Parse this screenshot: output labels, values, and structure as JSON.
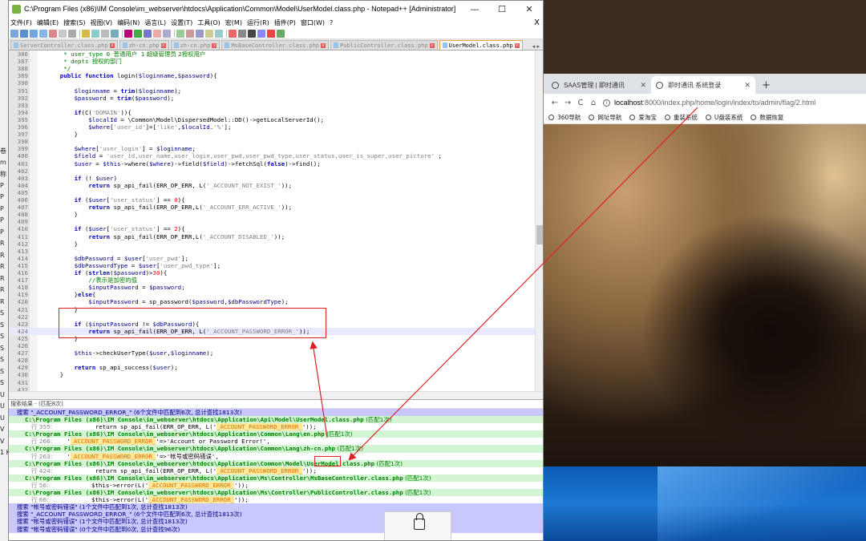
{
  "left_strip": {
    "labels": [
      "卷",
      "m",
      "称",
      "P",
      "P",
      "P",
      "P",
      "P",
      "R",
      "R",
      "R",
      "R",
      "R",
      "R",
      "S",
      "S",
      "S",
      "S",
      "S",
      "S",
      "S",
      "U",
      "U",
      "U",
      "V",
      "V",
      "1 K"
    ]
  },
  "npp": {
    "title": "C:\\Program Files (x86)\\IM Console\\im_webserver\\htdocs\\Application\\Common\\Model\\UserModel.class.php - Notepad++ [Administrator]",
    "window_buttons": {
      "minimize": "—",
      "maximize": "☐",
      "close": "✕"
    },
    "menu": [
      "文件(F)",
      "编辑(E)",
      "搜索(S)",
      "视图(V)",
      "编码(N)",
      "语言(L)",
      "设置(T)",
      "工具(O)",
      "宏(M)",
      "运行(R)",
      "插件(P)",
      "窗口(W)",
      "?"
    ],
    "menu_close": "X",
    "tabs": [
      {
        "label": "ServerController.class.php",
        "active": false
      },
      {
        "label": "zh-cn.php",
        "active": false
      },
      {
        "label": "zh-cn.php",
        "active": false
      },
      {
        "label": "MsBaseController.class.php",
        "active": false
      },
      {
        "label": "PublicController.class.php",
        "active": false
      },
      {
        "label": "UserModel.class.php",
        "active": true
      }
    ],
    "tab_arrows": "◂ ▸",
    "code_lines": [
      {
        "n": "386",
        "parts": [
          [
            "cmt",
            "     * user_type 0 "
          ],
          [
            "cmtz",
            "普通用户  1 超级管理员 2授权用户"
          ]
        ]
      },
      {
        "n": "387",
        "parts": [
          [
            "cmt",
            "     * depts "
          ],
          [
            "cmtz",
            "授权的部门"
          ]
        ]
      },
      {
        "n": "388",
        "parts": [
          [
            "cmt",
            "     */"
          ]
        ]
      },
      {
        "n": "389",
        "parts": [
          [
            "kw",
            "    public function "
          ],
          [
            "fn",
            "login("
          ],
          [
            "var",
            "$loginname"
          ],
          [
            "fn",
            ","
          ],
          [
            "var",
            "$password"
          ],
          [
            "fn",
            "){"
          ]
        ]
      },
      {
        "n": "390",
        "parts": [
          [
            "fn",
            ""
          ]
        ]
      },
      {
        "n": "391",
        "parts": [
          [
            "var",
            "        $loginname"
          ],
          [
            "fn",
            " = "
          ],
          [
            "kw",
            "trim"
          ],
          [
            "fn",
            "("
          ],
          [
            "var",
            "$loginname"
          ],
          [
            "fn",
            ");"
          ]
        ]
      },
      {
        "n": "392",
        "parts": [
          [
            "var",
            "        $password"
          ],
          [
            "fn",
            " = "
          ],
          [
            "kw",
            "trim"
          ],
          [
            "fn",
            "("
          ],
          [
            "var",
            "$password"
          ],
          [
            "fn",
            ");"
          ]
        ]
      },
      {
        "n": "393",
        "parts": [
          [
            "fn",
            ""
          ]
        ]
      },
      {
        "n": "394",
        "parts": [
          [
            "kw",
            "        if"
          ],
          [
            "fn",
            "(C("
          ],
          [
            "str",
            "'DOMAIN'"
          ],
          [
            "fn",
            ")){"
          ]
        ]
      },
      {
        "n": "395",
        "parts": [
          [
            "var",
            "            $localId"
          ],
          [
            "fn",
            " = \\Common\\Model\\DispersedModel::DD()->getLocalServerId();"
          ]
        ]
      },
      {
        "n": "396",
        "parts": [
          [
            "var",
            "            $where"
          ],
          [
            "fn",
            "["
          ],
          [
            "str",
            "'user_id'"
          ],
          [
            "fn",
            "]=["
          ],
          [
            "str",
            "'like'"
          ],
          [
            "fn",
            ","
          ],
          [
            "var",
            "$localId"
          ],
          [
            "fn",
            "."
          ],
          [
            "str",
            "'%'"
          ],
          [
            "fn",
            "];"
          ]
        ]
      },
      {
        "n": "397",
        "parts": [
          [
            "fn",
            "        }"
          ]
        ]
      },
      {
        "n": "398",
        "parts": [
          [
            "fn",
            ""
          ]
        ]
      },
      {
        "n": "399",
        "parts": [
          [
            "var",
            "        $where"
          ],
          [
            "fn",
            "["
          ],
          [
            "str",
            "'user_login'"
          ],
          [
            "fn",
            "] = "
          ],
          [
            "var",
            "$loginname"
          ],
          [
            "fn",
            ";"
          ]
        ]
      },
      {
        "n": "400",
        "parts": [
          [
            "var",
            "        $field"
          ],
          [
            "fn",
            " = "
          ],
          [
            "str",
            "'user_id,user_name,user_login,user_pwd,user_pwd_type,user_status,user_is_super,user_picture'"
          ],
          [
            "fn",
            " ;"
          ]
        ]
      },
      {
        "n": "401",
        "parts": [
          [
            "var",
            "        $user"
          ],
          [
            "fn",
            " = "
          ],
          [
            "var",
            "$this"
          ],
          [
            "fn",
            "->where("
          ],
          [
            "var",
            "$where"
          ],
          [
            "fn",
            ")->field("
          ],
          [
            "var",
            "$field"
          ],
          [
            "fn",
            ")->fetchSql("
          ],
          [
            "kw",
            "false"
          ],
          [
            "fn",
            ")->find();"
          ]
        ]
      },
      {
        "n": "402",
        "parts": [
          [
            "fn",
            ""
          ]
        ]
      },
      {
        "n": "403",
        "parts": [
          [
            "kw",
            "        if"
          ],
          [
            "fn",
            " (! "
          ],
          [
            "var",
            "$user"
          ],
          [
            "fn",
            ")"
          ]
        ]
      },
      {
        "n": "404",
        "parts": [
          [
            "kw",
            "            return "
          ],
          [
            "fn",
            "sp_api_fail(ERR_OP_ERR, L("
          ],
          [
            "str",
            "'_ACCOUNT_NOT_EXIST_'"
          ],
          [
            "fn",
            "));"
          ]
        ]
      },
      {
        "n": "405",
        "parts": [
          [
            "fn",
            ""
          ]
        ]
      },
      {
        "n": "406",
        "parts": [
          [
            "kw",
            "        if"
          ],
          [
            "fn",
            " ("
          ],
          [
            "var",
            "$user"
          ],
          [
            "fn",
            "["
          ],
          [
            "str",
            "'user_status'"
          ],
          [
            "fn",
            "] == "
          ],
          [
            "num",
            "0"
          ],
          [
            "fn",
            "){"
          ]
        ]
      },
      {
        "n": "407",
        "parts": [
          [
            "kw",
            "            return "
          ],
          [
            "fn",
            "sp_api_fail(ERR_OP_ERR,L("
          ],
          [
            "str",
            "'_ACCOUNT_ERR_ACTIVE_'"
          ],
          [
            "fn",
            "));"
          ]
        ]
      },
      {
        "n": "408",
        "parts": [
          [
            "fn",
            "        }"
          ]
        ]
      },
      {
        "n": "409",
        "parts": [
          [
            "fn",
            ""
          ]
        ]
      },
      {
        "n": "410",
        "parts": [
          [
            "kw",
            "        if"
          ],
          [
            "fn",
            " ("
          ],
          [
            "var",
            "$user"
          ],
          [
            "fn",
            "["
          ],
          [
            "str",
            "'user_status'"
          ],
          [
            "fn",
            "] == "
          ],
          [
            "num",
            "2"
          ],
          [
            "fn",
            "){"
          ]
        ]
      },
      {
        "n": "411",
        "parts": [
          [
            "kw",
            "            return "
          ],
          [
            "fn",
            "sp_api_fail(ERR_OP_ERR,L("
          ],
          [
            "str",
            "'_ACCOUNT_DISABLED_'"
          ],
          [
            "fn",
            "));"
          ]
        ]
      },
      {
        "n": "412",
        "parts": [
          [
            "fn",
            "        }"
          ]
        ]
      },
      {
        "n": "413",
        "parts": [
          [
            "fn",
            ""
          ]
        ]
      },
      {
        "n": "414",
        "parts": [
          [
            "var",
            "        $dbPassword"
          ],
          [
            "fn",
            " = "
          ],
          [
            "var",
            "$user"
          ],
          [
            "fn",
            "["
          ],
          [
            "str",
            "'user_pwd'"
          ],
          [
            "fn",
            "];"
          ]
        ]
      },
      {
        "n": "415",
        "parts": [
          [
            "var",
            "        $dbPasswordType"
          ],
          [
            "fn",
            " = "
          ],
          [
            "var",
            "$user"
          ],
          [
            "fn",
            "["
          ],
          [
            "str",
            "'user_pwd_type'"
          ],
          [
            "fn",
            "];"
          ]
        ]
      },
      {
        "n": "416",
        "parts": [
          [
            "kw",
            "        if "
          ],
          [
            "fn",
            "("
          ],
          [
            "kw",
            "strlen"
          ],
          [
            "fn",
            "("
          ],
          [
            "var",
            "$password"
          ],
          [
            "fn",
            ")>"
          ],
          [
            "num",
            "30"
          ],
          [
            "fn",
            "){"
          ]
        ]
      },
      {
        "n": "417",
        "parts": [
          [
            "cmt",
            "            //"
          ],
          [
            "cmtz",
            "表示是加密的值"
          ]
        ]
      },
      {
        "n": "418",
        "parts": [
          [
            "var",
            "            $inputPassword"
          ],
          [
            "fn",
            " = "
          ],
          [
            "var",
            "$password"
          ],
          [
            "fn",
            ";"
          ]
        ]
      },
      {
        "n": "419",
        "parts": [
          [
            "fn",
            "        }"
          ],
          [
            "kw",
            "else"
          ],
          [
            "fn",
            "{"
          ]
        ]
      },
      {
        "n": "420",
        "parts": [
          [
            "var",
            "            $inputPassword"
          ],
          [
            "fn",
            " = sp_password("
          ],
          [
            "var",
            "$password"
          ],
          [
            "fn",
            ","
          ],
          [
            "var",
            "$dbPasswordType"
          ],
          [
            "fn",
            ");"
          ]
        ]
      },
      {
        "n": "421",
        "parts": [
          [
            "fn",
            "        }"
          ]
        ]
      },
      {
        "n": "422",
        "parts": [
          [
            "fn",
            ""
          ]
        ]
      },
      {
        "n": "423",
        "parts": [
          [
            "kw",
            "        if"
          ],
          [
            "fn",
            " ("
          ],
          [
            "var",
            "$inputPassword"
          ],
          [
            "fn",
            " != "
          ],
          [
            "var",
            "$dbPassword"
          ],
          [
            "fn",
            "){"
          ]
        ]
      },
      {
        "n": "424",
        "parts": [
          [
            "kw",
            "            return "
          ],
          [
            "fn",
            "sp_api_fail(ERR_OP_ERR, L("
          ],
          [
            "str",
            "'_ACCOUNT_PASSWORD_ERROR_'"
          ],
          [
            "fn",
            "));"
          ]
        ]
      },
      {
        "n": "425",
        "parts": [
          [
            "fn",
            "        }"
          ]
        ]
      },
      {
        "n": "426",
        "parts": [
          [
            "fn",
            ""
          ]
        ]
      },
      {
        "n": "427",
        "parts": [
          [
            "var",
            "        $this"
          ],
          [
            "fn",
            "->checkUserType("
          ],
          [
            "var",
            "$user"
          ],
          [
            "fn",
            ","
          ],
          [
            "var",
            "$loginname"
          ],
          [
            "fn",
            ");"
          ]
        ]
      },
      {
        "n": "428",
        "parts": [
          [
            "fn",
            ""
          ]
        ]
      },
      {
        "n": "429",
        "parts": [
          [
            "kw",
            "        return "
          ],
          [
            "fn",
            "sp_api_success("
          ],
          [
            "var",
            "$user"
          ],
          [
            "fn",
            ");"
          ]
        ]
      },
      {
        "n": "430",
        "parts": [
          [
            "fn",
            "    }"
          ]
        ]
      },
      {
        "n": "431",
        "parts": [
          [
            "fn",
            ""
          ]
        ]
      },
      {
        "n": "432",
        "parts": [
          [
            "fn",
            ""
          ]
        ]
      }
    ],
    "highlighted_line": "424",
    "results_title": "搜索结果 - (匹配8次)",
    "results": [
      {
        "kind": "search",
        "text": "搜索 \"_ACCOUNT_PASSWORD_ERROR_\" (6个文件中匹配到6次, 总计查找1813次)"
      },
      {
        "kind": "file",
        "text": "C:\\Program Files (x86)\\IM Console\\im_webserver\\htdocs\\Application\\Api\\Model\\UserModel.class.php",
        "suffix": " (匹配1次)"
      },
      {
        "kind": "hit",
        "num": "行 355:",
        "before": "            return sp_api_fail(ERR_OP_ERR, L('",
        "match": "_ACCOUNT_PASSWORD_ERROR_",
        "after": "'));"
      },
      {
        "kind": "file",
        "text": "C:\\Program Files (x86)\\IM Console\\im_webserver\\htdocs\\Application\\Common\\Lang\\en.php",
        "suffix": " (匹配1次)"
      },
      {
        "kind": "hit",
        "num": "行 266:",
        "before": "    '",
        "match": "_ACCOUNT_PASSWORD_ERROR_",
        "after": "'=>'Account or Password Error!',"
      },
      {
        "kind": "file",
        "text": "C:\\Program Files (x86)\\IM Console\\im_webserver\\htdocs\\Application\\Common\\Lang\\zh-cn.php",
        "suffix": " (匹配1次)"
      },
      {
        "kind": "hit",
        "num": "行 263:",
        "before": "    '",
        "match": "_ACCOUNT_PASSWORD_ERROR_",
        "after": "'=>'帐号或密码错误',"
      },
      {
        "kind": "file",
        "text": "C:\\Program Files (x86)\\IM Console\\im_webserver\\htdocs\\Application\\Common\\Model\\UserModel.class.php",
        "suffix": " (匹配1次)"
      },
      {
        "kind": "hit",
        "num": "行 424:",
        "before": "            return sp_api_fail(ERR_OP_ERR, L('",
        "match": "_ACCOUNT_PASSWORD_ERROR_",
        "after": "'));"
      },
      {
        "kind": "file",
        "text": "C:\\Program Files (x86)\\IM Console\\im_webserver\\htdocs\\Application\\Ms\\Controller\\MsBaseController.class.php",
        "suffix": " (匹配1次)"
      },
      {
        "kind": "hit",
        "num": "行 56:",
        "before": "            $this->error(L('",
        "match": "_ACCOUNT_PASSWORD_ERROR_",
        "after": "'));"
      },
      {
        "kind": "file",
        "text": "C:\\Program Files (x86)\\IM Console\\im_webserver\\htdocs\\Application\\Ms\\Controller\\PublicController.class.php",
        "suffix": " (匹配1次)"
      },
      {
        "kind": "hit",
        "num": "行 66:",
        "before": "            $this->error(L('",
        "match": "_ACCOUNT_PASSWORD_ERROR_",
        "after": "'));"
      },
      {
        "kind": "search",
        "text": "搜索 \"帐号或密码错误\" (1个文件中匹配到1次, 总计查找1813次)"
      },
      {
        "kind": "search",
        "text": "搜索 \"_ACCOUNT_PASSWORD_ERROR_\" (6个文件中匹配到6次, 总计查找1813次)"
      },
      {
        "kind": "search",
        "text": "搜索 \"帐号或密码错误\" (1个文件中匹配到1次, 总计查找1813次)"
      },
      {
        "kind": "search",
        "text": "搜索 \"帐号或密码错误\" (0个文件中匹配到0次, 总计查找96次)"
      }
    ],
    "lock_label": "Unlock T"
  },
  "browser": {
    "tabs": [
      {
        "label": "SAAS管理 | 即时通讯",
        "close": "✕"
      },
      {
        "label": "即时通讯 系统登录",
        "close": "✕"
      }
    ],
    "new_tab": "+",
    "nav": {
      "back": "←",
      "forward": "→",
      "reload": "C",
      "home": "⌂"
    },
    "url_host": "localhost",
    "url_path": ":8000/index.php/home/login/index/to/admin/flag/2.html",
    "bookmarks": [
      "360导航",
      "网址导航",
      "爱淘宝",
      "重装系统",
      "U盘装系统",
      "数据恢复"
    ]
  },
  "colors": {
    "annotation_red": "#e02020",
    "search_header": "#c8c8ff",
    "file_header": "#d4f5d4",
    "match_highlight": "#ffe89a"
  }
}
